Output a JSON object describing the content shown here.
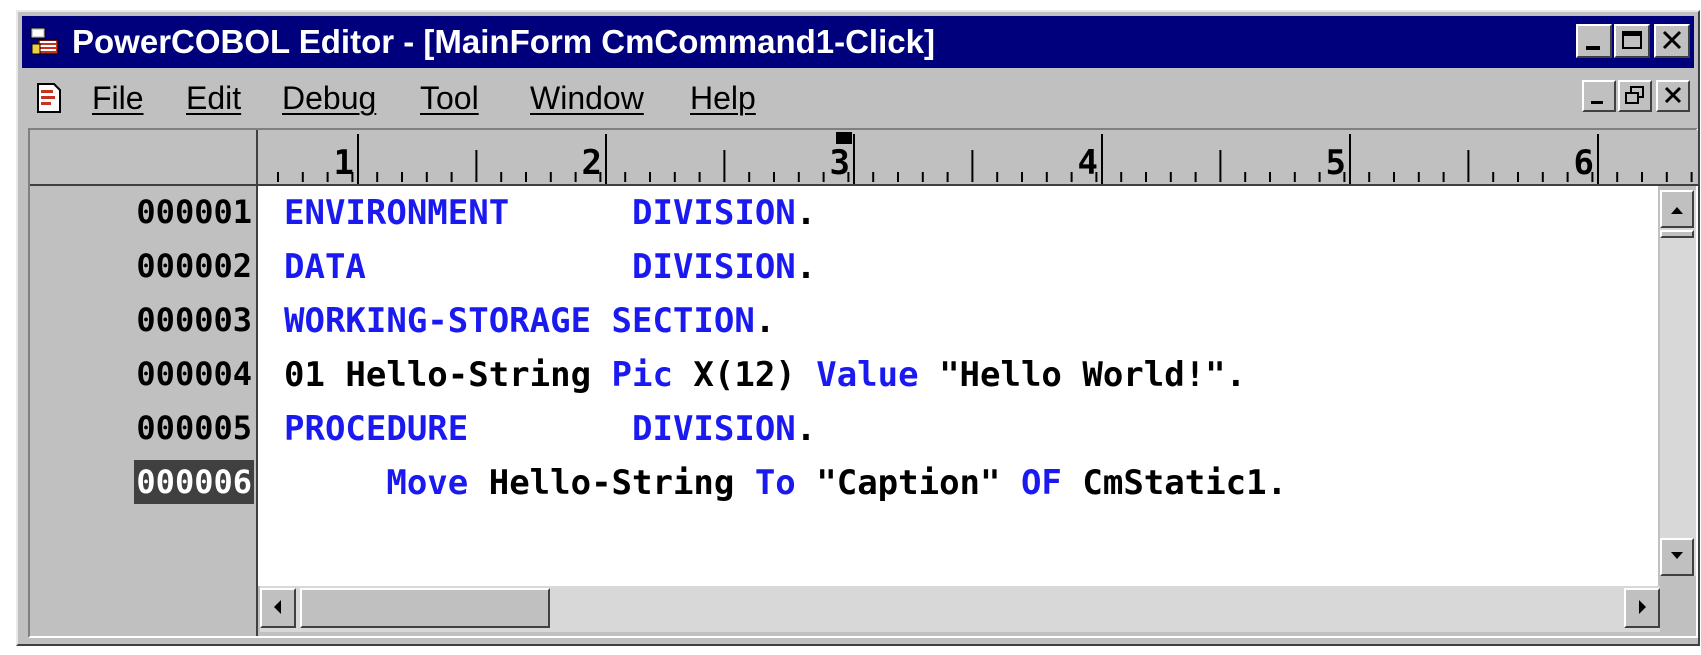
{
  "window": {
    "title": "PowerCOBOL Editor - [MainForm CmCommand1-Click]",
    "icon": "powercobol-app-icon",
    "caption_buttons": [
      "minimize-icon",
      "maximize-icon",
      "close-icon"
    ]
  },
  "menubar": {
    "doc_icon": "document-icon",
    "items": [
      {
        "label": "File"
      },
      {
        "label": "Edit"
      },
      {
        "label": "Debug"
      },
      {
        "label": "Tool"
      },
      {
        "label": "Window"
      },
      {
        "label": "Help"
      }
    ],
    "mdi_buttons": [
      "mdi-minimize-icon",
      "mdi-restore-icon",
      "mdi-close-icon"
    ]
  },
  "ruler": {
    "labels": [
      "1",
      "2",
      "3",
      "4",
      "5",
      "6"
    ]
  },
  "editor": {
    "line_numbers": [
      "000001",
      "000002",
      "000003",
      "000004",
      "000005",
      "000006"
    ],
    "selected_line": "000006",
    "lines": [
      {
        "segments": [
          {
            "text": "ENVIRONMENT      ",
            "kw": true
          },
          {
            "text": "DIVISION",
            "kw": true
          },
          {
            "text": ".",
            "kw": false
          }
        ]
      },
      {
        "segments": [
          {
            "text": "DATA             ",
            "kw": true
          },
          {
            "text": "DIVISION",
            "kw": true
          },
          {
            "text": ".",
            "kw": false
          }
        ]
      },
      {
        "segments": [
          {
            "text": "WORKING-STORAGE SECTION",
            "kw": true
          },
          {
            "text": ".",
            "kw": false
          }
        ]
      },
      {
        "segments": [
          {
            "text": "01 Hello-String ",
            "kw": false
          },
          {
            "text": "Pic",
            "kw": true
          },
          {
            "text": " X(12) ",
            "kw": false
          },
          {
            "text": "Value",
            "kw": true
          },
          {
            "text": " \"Hello World!\".",
            "kw": false
          }
        ]
      },
      {
        "segments": [
          {
            "text": "PROCEDURE        ",
            "kw": true
          },
          {
            "text": "DIVISION",
            "kw": true
          },
          {
            "text": ".",
            "kw": false
          }
        ]
      },
      {
        "segments": [
          {
            "text": "     ",
            "kw": false
          },
          {
            "text": "Move",
            "kw": true
          },
          {
            "text": " Hello-String ",
            "kw": false
          },
          {
            "text": "To",
            "kw": true
          },
          {
            "text": " \"Caption\" ",
            "kw": false
          },
          {
            "text": "OF",
            "kw": true
          },
          {
            "text": " CmStatic1.",
            "kw": false
          }
        ]
      }
    ]
  },
  "colors": {
    "title_bar": "#00007c",
    "keyword": "#1a1af0",
    "chrome": "#c0c0c0"
  }
}
